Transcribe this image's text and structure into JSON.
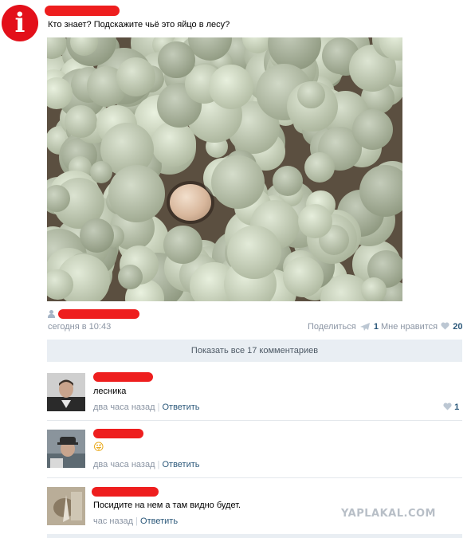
{
  "logo_glyph": "i",
  "post": {
    "text": "Кто знает? Подскажите чьё это яйцо в лесу?",
    "photo_subject": "egg-in-reindeer-moss",
    "time": "сегодня в 10:43",
    "share_label": "Поделиться",
    "share_count": "1",
    "like_label": "Мне нравится",
    "like_count": "20"
  },
  "show_all_comments": "Показать все 17 комментариев",
  "comments": [
    {
      "text": "лесника",
      "time": "два часа назад",
      "reply": "Ответить",
      "likes": "1"
    },
    {
      "text": "😜",
      "time": "два часа назад",
      "reply": "Ответить"
    },
    {
      "text": "Посидите на нем а там видно будет.",
      "time": "час назад",
      "reply": "Ответить"
    }
  ],
  "watermark": "YAPLAKAL.COM",
  "colors": {
    "redaction": "#ee1e1e",
    "link": "#2b587a",
    "meta": "#8a94a3",
    "button_bg": "#e9eef3",
    "logo": "#e3101a"
  }
}
